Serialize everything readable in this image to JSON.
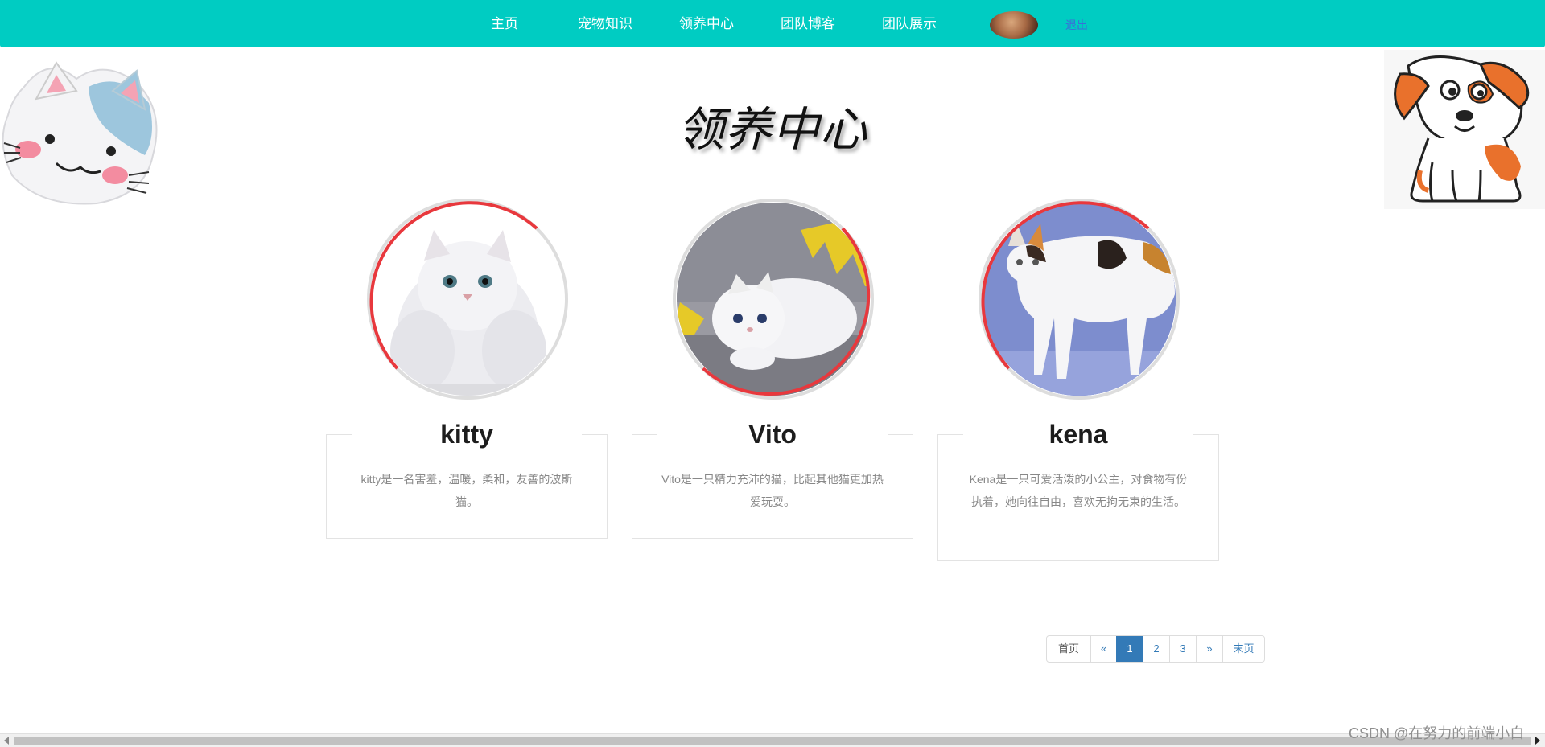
{
  "nav": {
    "items": [
      "主页",
      "宠物知识",
      "领养中心",
      "团队博客",
      "团队展示"
    ],
    "logout": "退出",
    "avatar_icon": "user-avatar"
  },
  "page": {
    "title": "领养中心"
  },
  "pets": [
    {
      "name": "kitty",
      "desc": "kitty是一名害羞，温暖，柔和，友善的波斯猫。"
    },
    {
      "name": "Vito",
      "desc": "Vito是一只精力充沛的猫，比起其他猫更加热爱玩耍。"
    },
    {
      "name": "kena",
      "desc": "Kena是一只可爱活泼的小公主，对食物有份执着，她向往自由，喜欢无拘无束的生活。"
    }
  ],
  "pagination": {
    "first": "首页",
    "prev": "«",
    "pages": [
      "1",
      "2",
      "3"
    ],
    "active_page": "1",
    "next": "»",
    "last": "末页"
  },
  "watermark": "CSDN @在努力的前端小白",
  "colors": {
    "nav_bg": "#00ccc2",
    "ring_accent": "#e8383d",
    "ring_base": "#dddddd",
    "active_page": "#337ab7"
  }
}
